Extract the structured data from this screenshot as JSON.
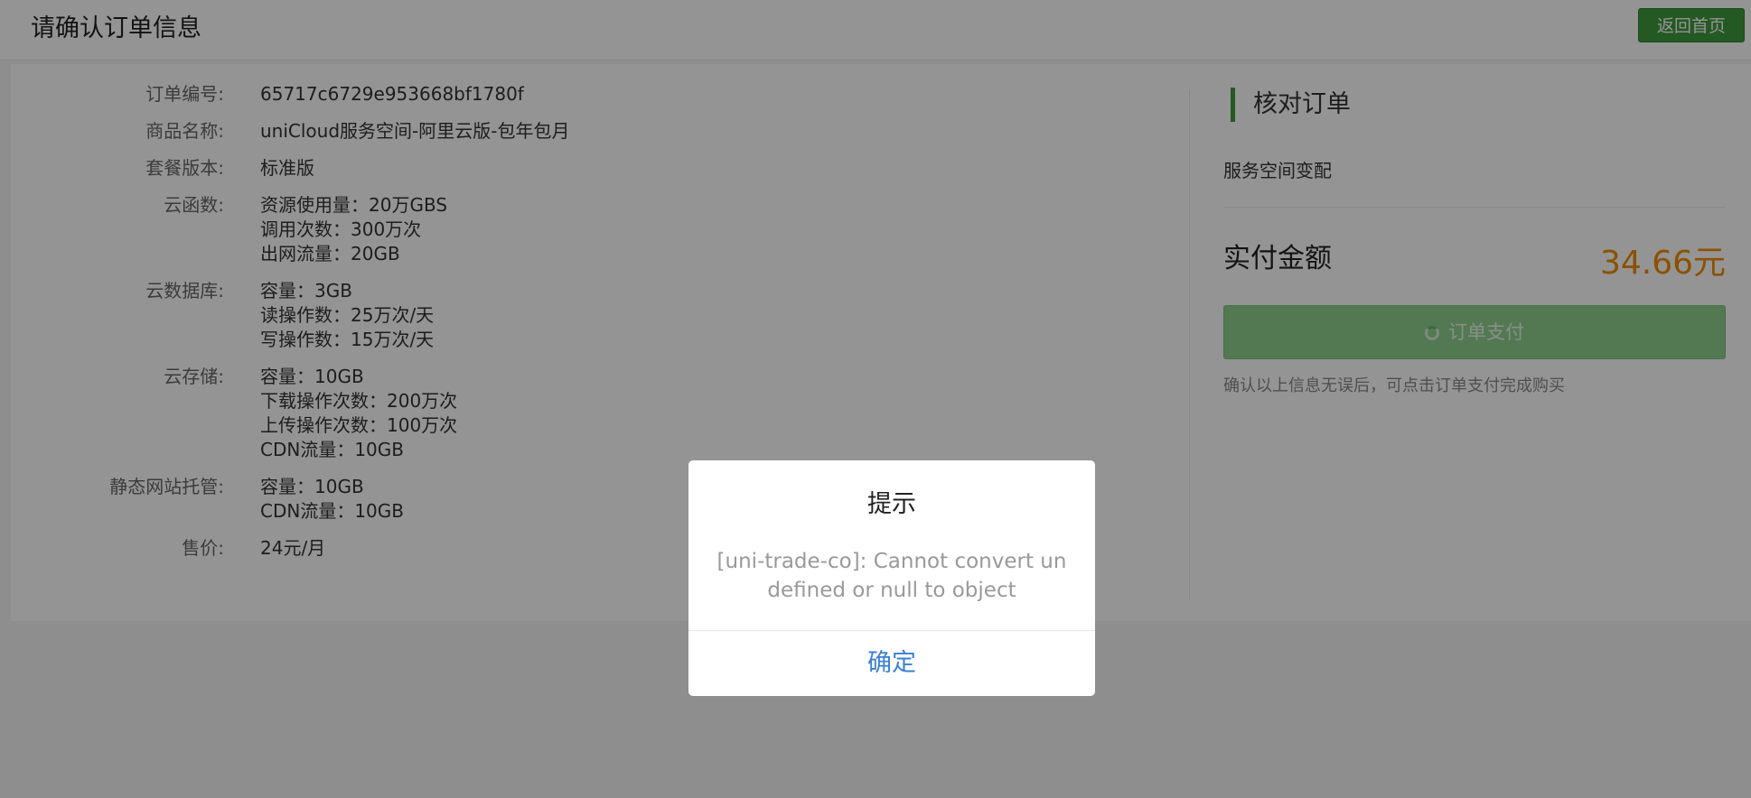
{
  "header": {
    "title": "请确认订单信息",
    "home_button": "返回首页"
  },
  "order": {
    "rows": [
      {
        "label": "订单编号:",
        "values": [
          "65717c6729e953668bf1780f"
        ]
      },
      {
        "label": "商品名称:",
        "values": [
          "uniCloud服务空间-阿里云版-包年包月"
        ]
      },
      {
        "label": "套餐版本:",
        "values": [
          "标准版"
        ]
      },
      {
        "label": "云函数:",
        "values": [
          "资源使用量：20万GBS",
          "调用次数：300万次",
          "出网流量：20GB"
        ]
      },
      {
        "label": "云数据库:",
        "values": [
          "容量：3GB",
          "读操作数：25万次/天",
          "写操作数：15万次/天"
        ]
      },
      {
        "label": "云存储:",
        "values": [
          "容量：10GB",
          "下载操作次数：200万次",
          "上传操作次数：100万次",
          "CDN流量：10GB"
        ]
      },
      {
        "label": "静态网站托管:",
        "values": [
          "容量：10GB",
          "CDN流量：10GB"
        ]
      },
      {
        "label": "售价:",
        "values": [
          "24元/月"
        ]
      }
    ]
  },
  "summary": {
    "title": "核对订单",
    "item": "服务空间变配",
    "amount_label": "实付金额",
    "amount_value": "34.66元",
    "pay_button": "订单支付",
    "hint": "确认以上信息无误后，可点击订单支付完成购买"
  },
  "modal": {
    "title": "提示",
    "content": "[uni-trade-co]: Cannot convert undefined or null to object",
    "confirm": "确定"
  },
  "colors": {
    "accent_green": "#3e9a3e",
    "pay_button_disabled": "#8fd08f",
    "amount_orange": "#f08c00",
    "confirm_blue": "#3a7fd4"
  }
}
